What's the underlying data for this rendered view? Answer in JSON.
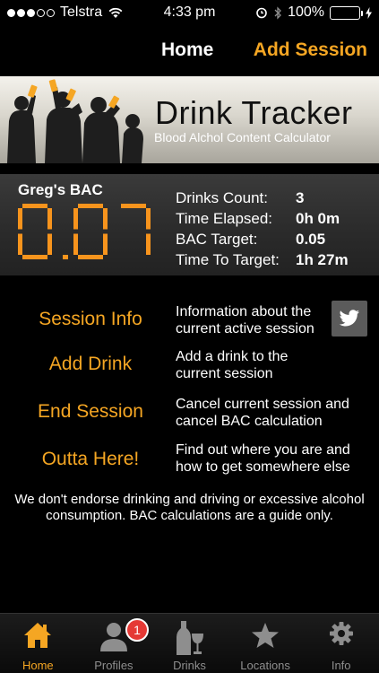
{
  "status_bar": {
    "carrier": "Telstra",
    "time": "4:33 pm",
    "battery": "100%"
  },
  "nav": {
    "title": "Home",
    "action": "Add Session"
  },
  "banner": {
    "title": "Drink Tracker",
    "subtitle": "Blood Alchol Content Calculator"
  },
  "bac": {
    "label": "Greg's BAC",
    "value": "0.07",
    "stats": [
      {
        "label": "Drinks Count:",
        "value": "3"
      },
      {
        "label": "Time Elapsed:",
        "value": "0h 0m"
      },
      {
        "label": "BAC Target:",
        "value": "0.05"
      },
      {
        "label": "Time To Target:",
        "value": "1h 27m"
      }
    ]
  },
  "menu": [
    {
      "label": "Session Info",
      "desc": "Information about the current active session"
    },
    {
      "label": "Add Drink",
      "desc": "Add a drink to the current session"
    },
    {
      "label": "End Session",
      "desc": "Cancel current session and cancel BAC calculation"
    },
    {
      "label": "Outta Here!",
      "desc": "Find out where you are and how to get somewhere else"
    }
  ],
  "disclaimer": "We don't endorse drinking and driving or excessive alcohol consumption. BAC calculations are a guide only.",
  "tabs": [
    {
      "label": "Home",
      "icon": "house-icon",
      "active": true
    },
    {
      "label": "Profiles",
      "icon": "person-icon",
      "badge": "1"
    },
    {
      "label": "Drinks",
      "icon": "bottle-glass-icon"
    },
    {
      "label": "Locations",
      "icon": "star-icon"
    },
    {
      "label": "Info",
      "icon": "gear-icon"
    }
  ],
  "colors": {
    "accent": "#f5a623",
    "lcd": "#f7941d",
    "badge": "#e53935",
    "battery": "#4cd964"
  }
}
